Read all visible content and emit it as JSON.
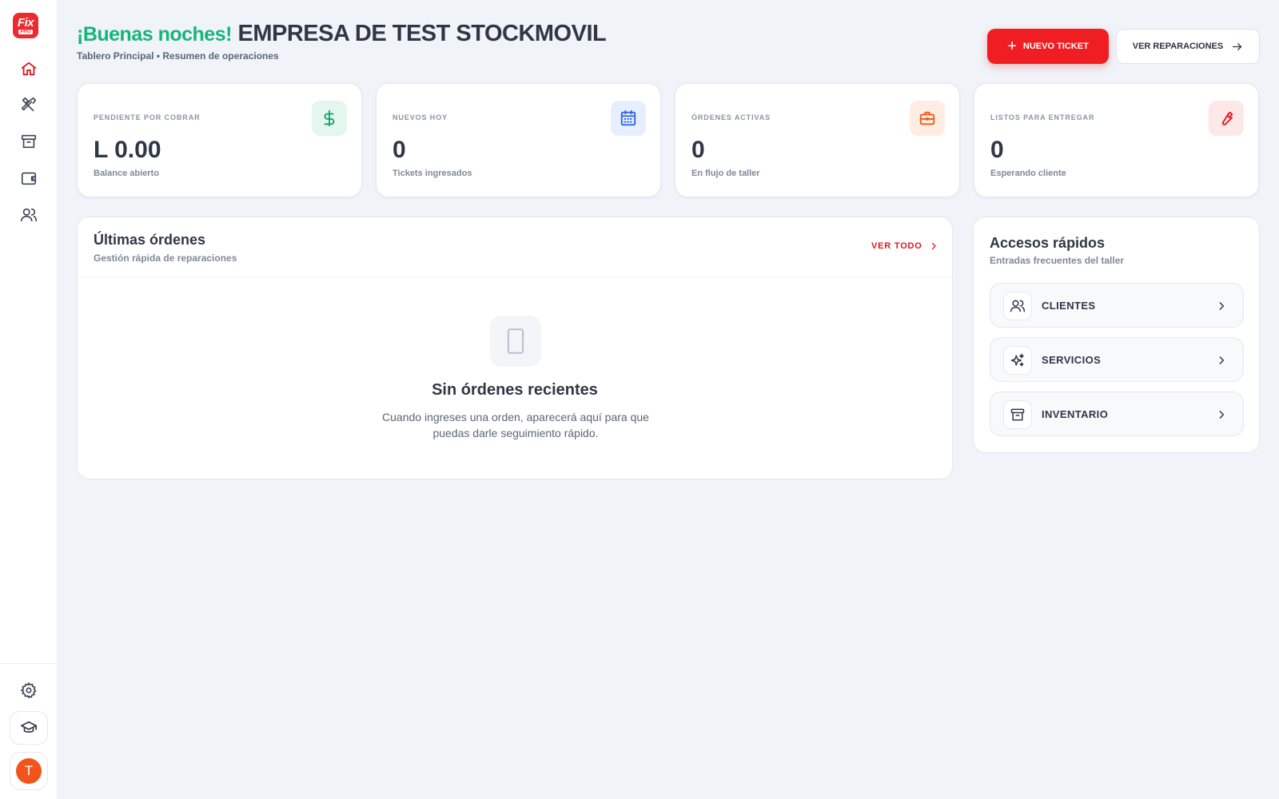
{
  "app": {
    "logo_text": "Fix",
    "logo_badge": "PRO"
  },
  "sidebar": {
    "items": [
      {
        "name": "home",
        "icon": "home-icon",
        "active": true
      },
      {
        "name": "repairs",
        "icon": "tools-icon"
      },
      {
        "name": "inventory",
        "icon": "archive-box-icon"
      },
      {
        "name": "wallet",
        "icon": "wallet-icon"
      },
      {
        "name": "clients",
        "icon": "users-icon"
      }
    ],
    "settings_icon": "gear-icon",
    "education_icon": "graduation-cap-icon",
    "avatar_initial": "T"
  },
  "header": {
    "greeting": "¡Buenas noches!",
    "company": "EMPRESA DE TEST STOCKMOVIL",
    "subtitle": "Tablero Principal • Resumen de operaciones",
    "new_ticket_label": "NUEVO TICKET",
    "view_repairs_label": "VER REPARACIONES"
  },
  "stats": [
    {
      "label": "PENDIENTE POR COBRAR",
      "value": "L 0.00",
      "sub": "Balance abierto",
      "icon": "dollar-icon",
      "color": "#0f9f6e",
      "bg": "#e4f7ef"
    },
    {
      "label": "NUEVOS HOY",
      "value": "0",
      "sub": "Tickets ingresados",
      "icon": "calendar-icon",
      "color": "#2f62e8",
      "bg": "#e7efff"
    },
    {
      "label": "ÓRDENES ACTIVAS",
      "value": "0",
      "sub": "En flujo de taller",
      "icon": "briefcase-icon",
      "color": "#ef5a14",
      "bg": "#ffede3"
    },
    {
      "label": "LISTOS PARA ENTREGAR",
      "value": "0",
      "sub": "Esperando cliente",
      "icon": "wrench-icon",
      "color": "#e3161c",
      "bg": "#fde8e8"
    }
  ],
  "orders": {
    "title": "Últimas órdenes",
    "subtitle": "Gestión rápida de reparaciones",
    "view_all_label": "VER TODO",
    "empty_icon": "smartphone-icon",
    "empty_title": "Sin órdenes recientes",
    "empty_desc": "Cuando ingreses una orden, aparecerá aquí para que puedas darle seguimiento rápido."
  },
  "quick": {
    "title": "Accesos rápidos",
    "subtitle": "Entradas frecuentes del taller",
    "items": [
      {
        "label": "CLIENTES",
        "icon": "users-icon"
      },
      {
        "label": "SERVICIOS",
        "icon": "sparkles-icon"
      },
      {
        "label": "INVENTARIO",
        "icon": "archive-box-icon"
      }
    ]
  },
  "colors": {
    "accent": "#f01e22",
    "greeting": "#16b47a",
    "background": "#f0f3f8"
  }
}
